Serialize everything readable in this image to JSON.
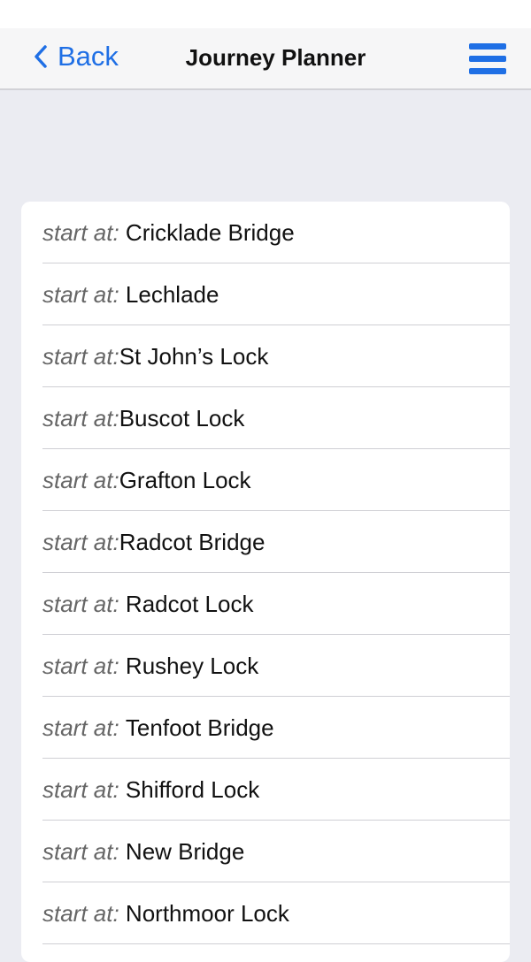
{
  "nav": {
    "back_label": "Back",
    "title": "Journey Planner",
    "accent_color": "#1f6fe5"
  },
  "icons": {
    "back": "chevron-left-icon",
    "menu": "hamburger-menu-icon"
  },
  "list": {
    "items": [
      {
        "prefix": "start at: ",
        "place": "Cricklade Bridge"
      },
      {
        "prefix": "start at: ",
        "place": "Lechlade"
      },
      {
        "prefix": "start at:",
        "place": "St John’s Lock"
      },
      {
        "prefix": "start at:",
        "place": "Buscot Lock"
      },
      {
        "prefix": "start at:",
        "place": "Grafton Lock"
      },
      {
        "prefix": "start at:",
        "place": "Radcot Bridge"
      },
      {
        "prefix": "start at: ",
        "place": "Radcot Lock"
      },
      {
        "prefix": "start at: ",
        "place": "Rushey Lock"
      },
      {
        "prefix": "start at: ",
        "place": "Tenfoot Bridge"
      },
      {
        "prefix": "start at: ",
        "place": "Shifford Lock"
      },
      {
        "prefix": "start at: ",
        "place": "New Bridge"
      },
      {
        "prefix": "start at: ",
        "place": "Northmoor Lock"
      }
    ]
  }
}
